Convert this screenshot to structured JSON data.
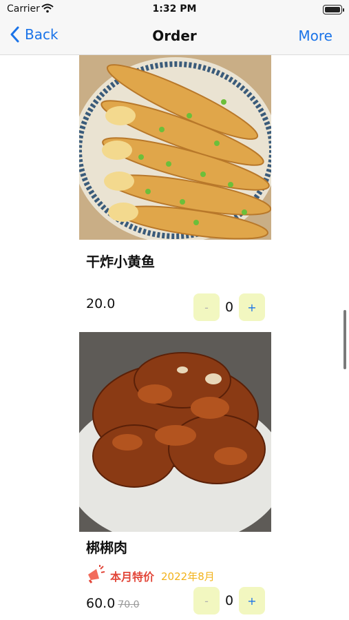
{
  "status": {
    "carrier": "Carrier",
    "time": "1:32 PM"
  },
  "nav": {
    "back_label": "Back",
    "title": "Order",
    "more_label": "More"
  },
  "dishes": [
    {
      "name": "干炸小黄鱼",
      "price": "20.0",
      "quantity": "0",
      "minus": "-",
      "plus": "+"
    },
    {
      "name": "梆梆肉",
      "price": "60.0",
      "old_price": "70.0",
      "quantity": "0",
      "minus": "-",
      "plus": "+",
      "promo_label": "本月特价",
      "promo_date": "2022年8月"
    }
  ],
  "colors": {
    "accent": "#1a73e8",
    "stepper_bg": "#f2f7c0",
    "promo": "#e2473a",
    "promo_date": "#f2b21a"
  },
  "icons": {
    "back": "chevron-left-icon",
    "wifi": "wifi-icon",
    "battery": "battery-icon",
    "promo": "megaphone-icon"
  }
}
